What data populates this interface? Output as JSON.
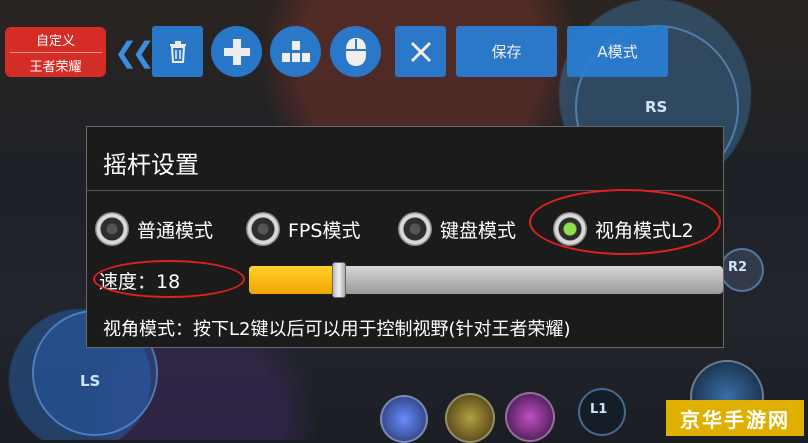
{
  "preset": {
    "line1": "自定义",
    "line2": "王者荣耀"
  },
  "toolbar": {
    "icons": [
      "trash-icon",
      "dpad-icon",
      "keyboard-icon",
      "mouse-icon",
      "close-icon"
    ],
    "save_label": "保存",
    "mode_label": "A模式"
  },
  "hud": {
    "rs": "RS",
    "ls": "LS",
    "r2": "R2",
    "l1": "L1"
  },
  "dialog": {
    "title": "摇杆设置",
    "modes": [
      {
        "label": "普通模式",
        "selected": false
      },
      {
        "label": "FPS模式",
        "selected": false
      },
      {
        "label": "键盘模式",
        "selected": false
      },
      {
        "label": "视角模式L2",
        "selected": true
      }
    ],
    "speed_label": "速度：18",
    "speed_fraction": 0.19,
    "description": "视角模式：按下L2键以后可以用于控制视野(针对王者荣耀)"
  },
  "watermark": "京华手游网",
  "colors": {
    "accent": "#2a7fd6",
    "slider": "#f0a500",
    "highlight": "#e02020",
    "selected_radio": "#8ee04a"
  }
}
